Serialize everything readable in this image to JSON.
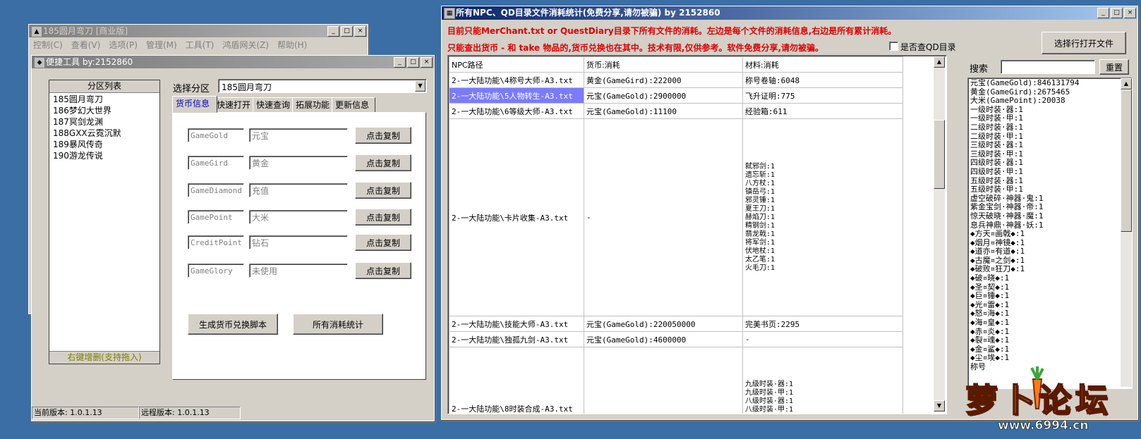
{
  "back_window": {
    "title": "185圆月弯刀 [商业版]",
    "menu": [
      "控制(C)",
      "查看(V)",
      "选项(P)",
      "管理(M)",
      "工具(T)",
      "鸿盾网关(Z)",
      "帮助(H)"
    ]
  },
  "tool_window": {
    "title": "便捷工具  by:2152860",
    "partition_list": {
      "header": "分区列表",
      "items": [
        "185圆月弯刀",
        "186梦幻大世界",
        "187冥剑龙渊",
        "188GXX云霓沉默",
        "189暴风传奇",
        "190游龙传说"
      ],
      "footer": "右键增删(支持拖入)"
    },
    "select_label": "选择分区",
    "select_value": "185圆月弯刀",
    "tabs": [
      "货币信息",
      "快速打开",
      "快速查询",
      "拓展功能",
      "更新信息"
    ],
    "currency_rows": [
      {
        "code": "GameGold",
        "name": "元宝",
        "button": "点击复制"
      },
      {
        "code": "GameGird",
        "name": "黄金",
        "button": "点击复制"
      },
      {
        "code": "GameDiamond",
        "name": "充值",
        "button": "点击复制"
      },
      {
        "code": "GamePoint",
        "name": "大米",
        "button": "点击复制"
      },
      {
        "code": "CreditPoint",
        "name": "钻石",
        "button": "点击复制"
      },
      {
        "code": "GameGlory",
        "name": "未使用",
        "button": "点击复制"
      }
    ],
    "gen_button": "生成货币兑换脚本",
    "stats_button": "所有消耗统计",
    "status_current": "当前版本: 1.0.1.13",
    "status_remote": "远程版本: 1.0.1.13"
  },
  "stats_window": {
    "title": "所有NPC、QD目录文件消耗统计(免费分享,请勿被骗)     by 2152860",
    "notice1": "目前只能MerChant.txt or QuestDiary目录下所有文件的消耗。左边是每个文件的消耗信息,右边是所有累计消耗。",
    "notice2": "只能查出货币 - 和 take 物品的,货币兑换也在其中。技术有限,仅供参考。软件免费分享,请勿被骗。",
    "checkbox_label": "是否查QD目录",
    "open_button": "选择行打开文件",
    "search_label": "搜索",
    "search_value": "",
    "reset_button": "重置",
    "columns": [
      "NPC路径",
      "货币:消耗",
      "材料:消耗"
    ],
    "rows": [
      {
        "path": "2-一大陆功能\\4称号大师-A3.txt",
        "currency": "黄金(GameGird):222000",
        "material": [
          "称号卷轴:6048"
        ],
        "selected": false
      },
      {
        "path": "2-一大陆功能\\5人物转生-A3.txt",
        "currency": "元宝(GameGold):2900000",
        "material": [
          "飞升证明:775"
        ],
        "selected": true
      },
      {
        "path": "2-一大陆功能\\6等级大师-A3.txt",
        "currency": "元宝(GameGold):11100",
        "material": [
          "经验箱:611"
        ],
        "selected": false
      },
      {
        "path": "2-一大陆功能\\卡片收集-A3.txt",
        "currency": "-",
        "material": [
          "弑邪剑:1",
          "遗忘斩:1",
          "八方杖:1",
          "镇岳弓:1",
          "邪灵锤:1",
          "夏王刀:1",
          "赫焰刀:1",
          "精钢剑:1",
          "翡龙戟:1",
          "将军剑:1",
          "伏地杖:1",
          "太乙笔:1",
          "火毛刀:1"
        ],
        "selected": false
      },
      {
        "path": "2-一大陆功能\\技能大师-A3.txt",
        "currency": "元宝(GameGold):220050000",
        "material": [
          "完美书页:2295"
        ],
        "selected": false
      },
      {
        "path": "2-一大陆功能\\独孤九剑-A3.txt",
        "currency": "元宝(GameGold):4600000",
        "material": [
          "-"
        ],
        "selected": false
      },
      {
        "path": "2-一大陆功能\\8时装合成-A3.txt",
        "currency": "",
        "material": [
          "九级时装·器:1",
          "九级时装·甲:1",
          "八级时装·器:1",
          "八级时装·甲:1"
        ],
        "selected": false
      }
    ],
    "totals": [
      "元宝(GameGold):846131794",
      "黄金(GameGird):2675465",
      "大米(GamePoint):20038",
      "一级时装·器:1",
      "一级时装·甲:1",
      "二级时装·器:1",
      "二级时装·甲:1",
      "三级时装·器:1",
      "三级时装·甲:1",
      "四级时装·器:1",
      "四级时装·甲:1",
      "五级时装·器:1",
      "五级时装·甲:1",
      "虚空破碎·神器·鬼:1",
      "紫金宝剑·神器·帝:1",
      "惊天破晓·神器·魔:1",
      "息兵神鼎·神器·妖:1",
      "◆方天¤画戟◆:1",
      "◆烟月¤神镜◆:1",
      "◆道亦¤有道◆:1",
      "◆古魔¤之剑◆:1",
      "◆破败¤狂刀◆:1",
      "◆破¤晓◆:1",
      "◆圣¤契◆:1",
      "◆巨¤锤◆:1",
      "◆光¤雷◆:1",
      "◆怒¤海◆:1",
      "◆海¤皇◆:1",
      "◆赤¤炎◆:1",
      "◆裂¤魂◆:1",
      "◆金¤鲨◆:1",
      "◆尘¤埃◆:1",
      "称号"
    ]
  },
  "watermark": {
    "brand": "萝卜论坛",
    "site": "www.6994.cn"
  }
}
